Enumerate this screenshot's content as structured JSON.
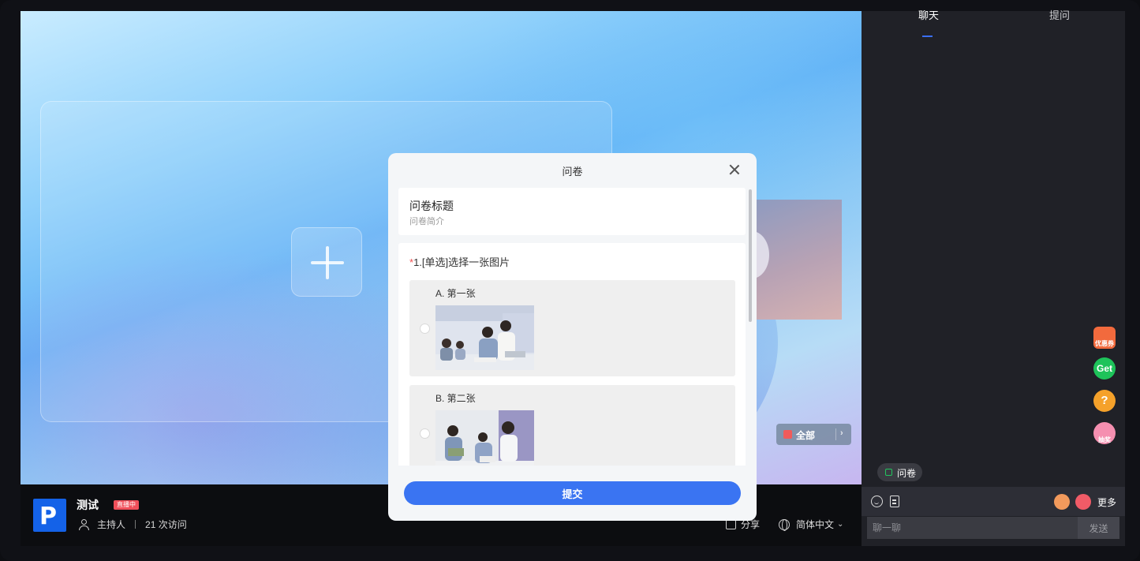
{
  "stage": {
    "all_button_label": "全部",
    "all_button_chevron": "›"
  },
  "room": {
    "logo_letter": "P",
    "title": "测试",
    "live_badge": "直播中",
    "host_label": "主持人",
    "visits": "21 次访问",
    "share_label": "分享",
    "language": "简体中文",
    "language_chevron": "⌄"
  },
  "right_panel": {
    "tabs": [
      {
        "label": "聊天",
        "active": true
      },
      {
        "label": "提问",
        "active": false
      }
    ],
    "float_icons": [
      {
        "name": "coupon-icon",
        "label": "优惠券",
        "color": "#f26a3d"
      },
      {
        "name": "get-icon",
        "label": "Get",
        "color": "#1ec35a"
      },
      {
        "name": "question-icon",
        "label": "?",
        "color": "#f5a12a"
      },
      {
        "name": "lucky-draw-icon",
        "label": "抽奖",
        "color": "#f58fb0"
      }
    ],
    "quiz_pill_label": "问卷",
    "more_label": "更多",
    "chat_placeholder": "聊一聊",
    "send_label": "发送"
  },
  "modal": {
    "title": "问卷",
    "survey_title": "问卷标题",
    "survey_intro": "问卷简介",
    "question": {
      "required_mark": "*",
      "text": "1.[单选]选择一张图片",
      "options": [
        {
          "label": "A. 第一张"
        },
        {
          "label": "B. 第二张"
        }
      ]
    },
    "submit_label": "提交"
  },
  "colors": {
    "accent": "#3a74f2",
    "live_badge": "#f04f5a",
    "panel_bg": "#202127"
  }
}
